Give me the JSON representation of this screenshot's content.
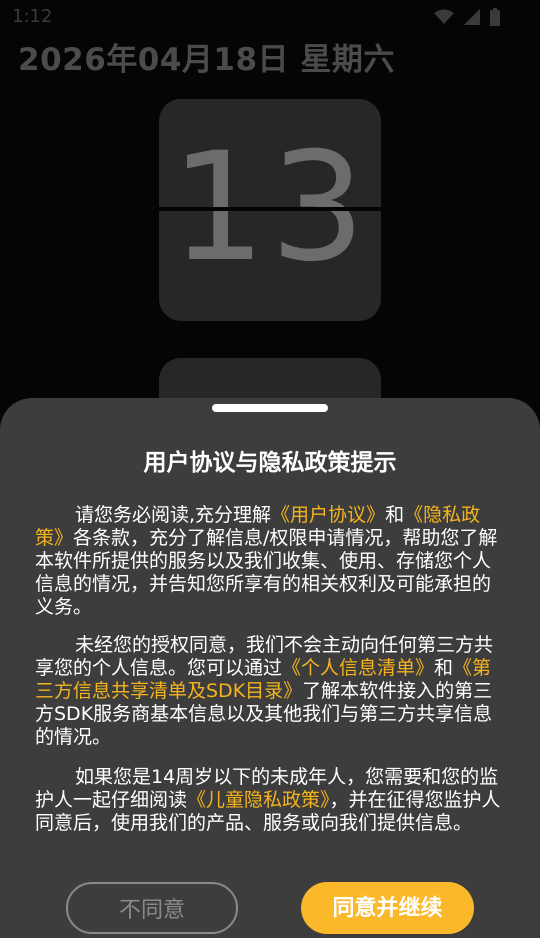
{
  "status_bar": {
    "time": "1:12"
  },
  "clock": {
    "date": "2026年04月18日 星期六",
    "hours": "13",
    "minutes": ""
  },
  "dialog": {
    "title": "用户协议与隐私政策提示",
    "p1_a": "请您务必阅读,充分理解",
    "p1_link1": "《用户协议》",
    "p1_b": "和",
    "p1_link2": "《隐私政策》",
    "p1_c": "各条款，充分了解信息/权限申请情况，帮助您了解本软件所提供的服务以及我们收集、使用、存储您个人信息的情况，并告知您所享有的相关权利及可能承担的义务。",
    "p2_a": "未经您的授权同意，我们不会主动向任何第三方共享您的个人信息。您可以通过",
    "p2_link1": "《个人信息清单》",
    "p2_b": "和",
    "p2_link2": "《第三方信息共享清单及SDK目录》",
    "p2_c": "了解本软件接入的第三方SDK服务商基本信息以及其他我们与第三方共享信息的情况。",
    "p3_a": "如果您是14周岁以下的未成年人，您需要和您的监护人一起仔细阅读",
    "p3_link1": "《儿童隐私政策》",
    "p3_b": "，并在征得您监护人同意后，使用我们的产品、服务或向我们提供信息。",
    "decline_label": "不同意",
    "agree_label": "同意并继续"
  },
  "colors": {
    "accent": "#fbb82a",
    "link": "#f5b41e",
    "sheet_bg": "#3d3d3d",
    "screen_bg": "#050505"
  },
  "icons": [
    "wifi-icon",
    "signal-icon",
    "battery-icon"
  ]
}
